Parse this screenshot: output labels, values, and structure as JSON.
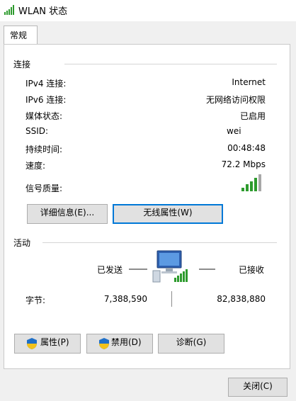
{
  "window": {
    "title": "WLAN 状态",
    "icon": "wifi-signal-icon"
  },
  "tabs": [
    {
      "label": "常规",
      "active": true
    }
  ],
  "connection": {
    "section_label": "连接",
    "rows": [
      {
        "label": "IPv4 连接:",
        "value": "Internet"
      },
      {
        "label": "IPv6 连接:",
        "value": "无网络访问权限"
      },
      {
        "label": "媒体状态:",
        "value": "已启用"
      },
      {
        "label": "SSID:",
        "value": "wei"
      },
      {
        "label": "持续时间:",
        "value": "00:48:48"
      },
      {
        "label": "速度:",
        "value": "72.2 Mbps"
      }
    ],
    "signal_label": "信号质量:",
    "signal_bars": 4,
    "signal_max": 5,
    "buttons": {
      "details": "详细信息(E)...",
      "wireless_props": "无线属性(W)"
    }
  },
  "activity": {
    "section_label": "活动",
    "sent_label": "已发送",
    "received_label": "已接收",
    "bytes_label": "字节:",
    "bytes_sent": "7,388,590",
    "bytes_received": "82,838,880"
  },
  "actions": {
    "properties": "属性(P)",
    "disable": "禁用(D)",
    "diagnose": "诊断(G)"
  },
  "footer": {
    "close": "关闭(C)"
  },
  "colors": {
    "accent": "#0078d7",
    "signal": "#2e9b2e",
    "shield_blue": "#1f6fc7",
    "shield_yellow": "#f2c21b"
  }
}
